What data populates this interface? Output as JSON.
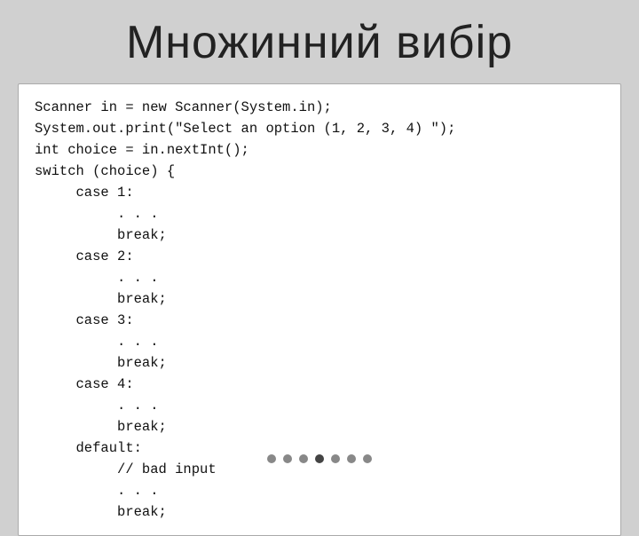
{
  "title": "Множинний вибір",
  "code": {
    "lines": [
      "Scanner in = new Scanner(System.in);",
      "System.out.print(\"Select an option (1, 2, 3, 4) \");",
      "int choice = in.nextInt();",
      "switch (choice) {",
      "     case 1:",
      "          . . .",
      "          break;",
      "     case 2:",
      "          . . .",
      "          break;",
      "     case 3:",
      "          . . .",
      "          break;",
      "     case 4:",
      "          . . .",
      "          break;",
      "     default:",
      "          // bad input",
      "          . . .",
      "          break;"
    ]
  },
  "dots": [
    {
      "active": false
    },
    {
      "active": false
    },
    {
      "active": false
    },
    {
      "active": true
    },
    {
      "active": false
    },
    {
      "active": false
    },
    {
      "active": false
    }
  ]
}
